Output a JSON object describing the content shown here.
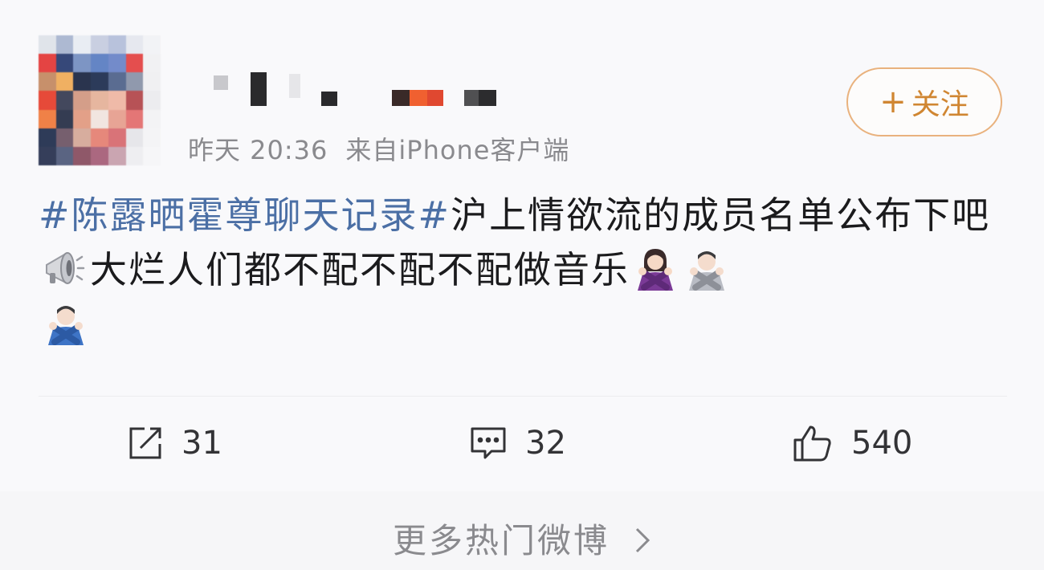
{
  "post": {
    "meta": {
      "time": "昨天 20:36",
      "source": "来自iPhone客户端"
    },
    "follow_label": "关注",
    "follow_plus": "+",
    "text": {
      "hashtag1": "#陈露晒霍尊聊天记录#",
      "line_part1": "沪上情欲流的成员名单公布下吧",
      "line_part2": "大烂人们都不配不配不配做音乐"
    },
    "emojis": [
      "megaphone-emoji",
      "woman-gesturing-no-emoji",
      "man-gesturing-no-emoji",
      "man-gesturing-no-emoji"
    ],
    "actions": {
      "repost_count": "31",
      "comment_count": "32",
      "like_count": "540"
    }
  },
  "footer": {
    "more_label": "更多热门微博"
  },
  "colors": {
    "hashtag": "#4b6fa5",
    "follow_accent": "#d08632",
    "follow_border": "#e9b27e",
    "meta_gray": "#8a8a8e"
  }
}
